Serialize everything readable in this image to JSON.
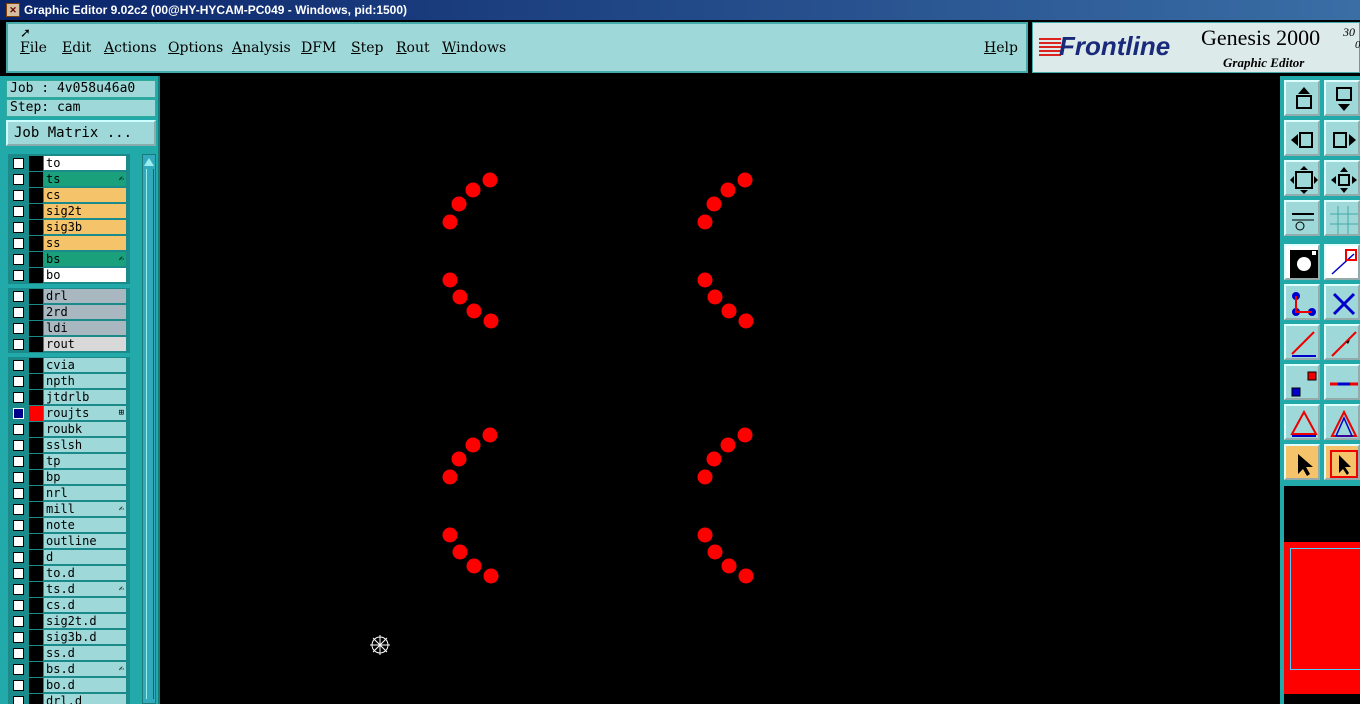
{
  "window": {
    "title": "Graphic Editor 9.02c2 (00@HY-HYCAM-PC049 - Windows, pid:1500)"
  },
  "menu": {
    "items": [
      "File",
      "Edit",
      "Actions",
      "Options",
      "Analysis",
      "DFM",
      "Step",
      "Rout",
      "Windows"
    ],
    "help": "Help"
  },
  "logo": {
    "brand": "Frontline",
    "product": "Genesis 2000",
    "sup_line1": "30",
    "sup_line2": "0",
    "subtitle": "Graphic Editor"
  },
  "job": {
    "job_label": "Job : 4v058u46a0",
    "step_label": "Step: cam",
    "matrix_button": "Job Matrix ..."
  },
  "layers": [
    {
      "name": "to",
      "color": "#ffffff",
      "indicator": ""
    },
    {
      "name": "ts",
      "color": "#1aa07a",
      "indicator": "✍"
    },
    {
      "name": "cs",
      "color": "#f5c36a",
      "indicator": ""
    },
    {
      "name": "sig2t",
      "color": "#f5c36a",
      "indicator": ""
    },
    {
      "name": "sig3b",
      "color": "#f5c36a",
      "indicator": ""
    },
    {
      "name": "ss",
      "color": "#f5c36a",
      "indicator": ""
    },
    {
      "name": "bs",
      "color": "#1aa07a",
      "indicator": "✍"
    },
    {
      "name": "bo",
      "color": "#ffffff",
      "indicator": ""
    },
    {
      "name": "drl",
      "color": "#a9b8c0",
      "indicator": ""
    },
    {
      "name": "2rd",
      "color": "#a9b8c0",
      "indicator": ""
    },
    {
      "name": "ldi",
      "color": "#a9b8c0",
      "indicator": ""
    },
    {
      "name": "rout",
      "color": "#d8d8d8",
      "indicator": ""
    },
    {
      "name": "cvia",
      "color": "#9ed8d8",
      "indicator": ""
    },
    {
      "name": "npth",
      "color": "#9ed8d8",
      "indicator": ""
    },
    {
      "name": "jtdrlb",
      "color": "#9ed8d8",
      "indicator": ""
    },
    {
      "name": "roujts",
      "color": "#9ed8d8",
      "indicator": "⊞",
      "active": true
    },
    {
      "name": "roubk",
      "color": "#9ed8d8",
      "indicator": ""
    },
    {
      "name": "sslsh",
      "color": "#9ed8d8",
      "indicator": ""
    },
    {
      "name": "tp",
      "color": "#9ed8d8",
      "indicator": ""
    },
    {
      "name": "bp",
      "color": "#9ed8d8",
      "indicator": ""
    },
    {
      "name": "nrl",
      "color": "#9ed8d8",
      "indicator": ""
    },
    {
      "name": "mill",
      "color": "#9ed8d8",
      "indicator": "✍"
    },
    {
      "name": "note",
      "color": "#9ed8d8",
      "indicator": ""
    },
    {
      "name": "outline",
      "color": "#9ed8d8",
      "indicator": ""
    },
    {
      "name": "d",
      "color": "#9ed8d8",
      "indicator": ""
    },
    {
      "name": "to.d",
      "color": "#9ed8d8",
      "indicator": ""
    },
    {
      "name": "ts.d",
      "color": "#9ed8d8",
      "indicator": "✍"
    },
    {
      "name": "cs.d",
      "color": "#9ed8d8",
      "indicator": ""
    },
    {
      "name": "sig2t.d",
      "color": "#9ed8d8",
      "indicator": ""
    },
    {
      "name": "sig3b.d",
      "color": "#9ed8d8",
      "indicator": ""
    },
    {
      "name": "ss.d",
      "color": "#9ed8d8",
      "indicator": ""
    },
    {
      "name": "bs.d",
      "color": "#9ed8d8",
      "indicator": "✍"
    },
    {
      "name": "bo.d",
      "color": "#9ed8d8",
      "indicator": ""
    },
    {
      "name": "drl.d",
      "color": "#9ed8d8",
      "indicator": ""
    }
  ],
  "colors": {
    "feature_red": "#ff0000",
    "panel_teal": "#2aa",
    "menu_bg": "#9ed8d8"
  }
}
